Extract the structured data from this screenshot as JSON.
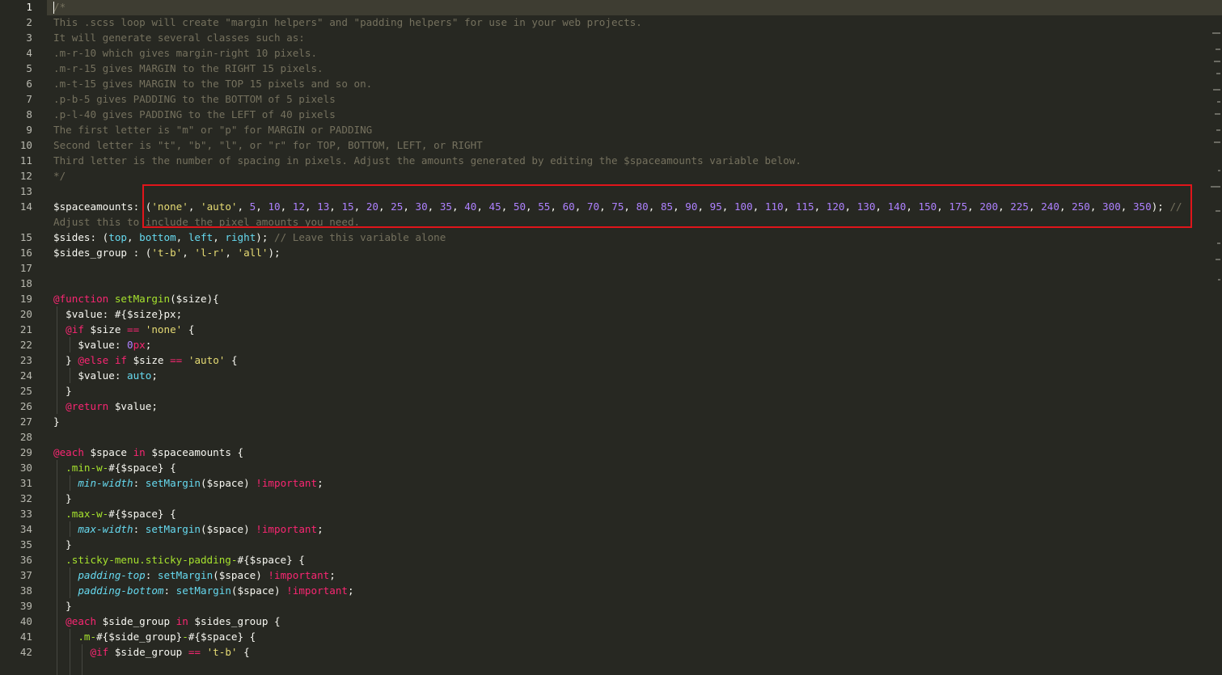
{
  "editor": {
    "language": "scss",
    "current_line": 1,
    "highlight_color": "#e0151b",
    "theme_colors": {
      "background": "#272822",
      "comment": "#75715e",
      "string": "#e6db74",
      "number": "#ae81ff",
      "keyword": "#f92672",
      "function": "#66d9ef",
      "selector": "#a6e22e"
    }
  },
  "line_numbers": [
    "1",
    "2",
    "3",
    "4",
    "5",
    "6",
    "7",
    "8",
    "9",
    "10",
    "11",
    "12",
    "13",
    "14",
    "15",
    "16",
    "17",
    "18",
    "19",
    "20",
    "21",
    "22",
    "23",
    "24",
    "25",
    "26",
    "27",
    "28",
    "29",
    "30",
    "31",
    "32",
    "33",
    "34",
    "35",
    "36",
    "37",
    "38",
    "39",
    "40",
    "41",
    "42"
  ],
  "lines": [
    [
      [
        "c",
        "/*"
      ]
    ],
    [
      [
        "c",
        "This .scss loop will create \"margin helpers\" and \"padding helpers\" for use in your web projects."
      ]
    ],
    [
      [
        "c",
        "It will generate several classes such as:"
      ]
    ],
    [
      [
        "c",
        ".m-r-10 which gives margin-right 10 pixels."
      ]
    ],
    [
      [
        "c",
        ".m-r-15 gives MARGIN to the RIGHT 15 pixels."
      ]
    ],
    [
      [
        "c",
        ".m-t-15 gives MARGIN to the TOP 15 pixels and so on."
      ]
    ],
    [
      [
        "c",
        ".p-b-5 gives PADDING to the BOTTOM of 5 pixels"
      ]
    ],
    [
      [
        "c",
        ".p-l-40 gives PADDING to the LEFT of 40 pixels"
      ]
    ],
    [
      [
        "c",
        "The first letter is \"m\" or \"p\" for MARGIN or PADDING"
      ]
    ],
    [
      [
        "c",
        "Second letter is \"t\", \"b\", \"l\", or \"r\" for TOP, BOTTOM, LEFT, or RIGHT"
      ]
    ],
    [
      [
        "c",
        "Third letter is the number of spacing in pixels. Adjust the amounts generated by editing the $spaceamounts variable below."
      ]
    ],
    [
      [
        "c",
        "*/"
      ]
    ],
    [],
    [
      [
        "p",
        "$spaceamounts: ("
      ],
      [
        "s",
        "'none'"
      ],
      [
        "p",
        ", "
      ],
      [
        "s",
        "'auto'"
      ],
      [
        "p",
        ", "
      ],
      [
        "n",
        "5"
      ],
      [
        "p",
        ", "
      ],
      [
        "n",
        "10"
      ],
      [
        "p",
        ", "
      ],
      [
        "n",
        "12"
      ],
      [
        "p",
        ", "
      ],
      [
        "n",
        "13"
      ],
      [
        "p",
        ", "
      ],
      [
        "n",
        "15"
      ],
      [
        "p",
        ", "
      ],
      [
        "n",
        "20"
      ],
      [
        "p",
        ", "
      ],
      [
        "n",
        "25"
      ],
      [
        "p",
        ", "
      ],
      [
        "n",
        "30"
      ],
      [
        "p",
        ", "
      ],
      [
        "n",
        "35"
      ],
      [
        "p",
        ", "
      ],
      [
        "n",
        "40"
      ],
      [
        "p",
        ", "
      ],
      [
        "n",
        "45"
      ],
      [
        "p",
        ", "
      ],
      [
        "n",
        "50"
      ],
      [
        "p",
        ", "
      ],
      [
        "n",
        "55"
      ],
      [
        "p",
        ", "
      ],
      [
        "n",
        "60"
      ],
      [
        "p",
        ", "
      ],
      [
        "n",
        "70"
      ],
      [
        "p",
        ", "
      ],
      [
        "n",
        "75"
      ],
      [
        "p",
        ", "
      ],
      [
        "n",
        "80"
      ],
      [
        "p",
        ", "
      ],
      [
        "n",
        "85"
      ],
      [
        "p",
        ", "
      ],
      [
        "n",
        "90"
      ],
      [
        "p",
        ", "
      ],
      [
        "n",
        "95"
      ],
      [
        "p",
        ", "
      ],
      [
        "n",
        "100"
      ],
      [
        "p",
        ", "
      ],
      [
        "n",
        "110"
      ],
      [
        "p",
        ", "
      ],
      [
        "n",
        "115"
      ],
      [
        "p",
        ", "
      ],
      [
        "n",
        "120"
      ],
      [
        "p",
        ", "
      ],
      [
        "n",
        "130"
      ],
      [
        "p",
        ", "
      ],
      [
        "n",
        "140"
      ],
      [
        "p",
        ", "
      ],
      [
        "n",
        "150"
      ],
      [
        "p",
        ", "
      ],
      [
        "n",
        "175"
      ],
      [
        "p",
        ", "
      ],
      [
        "n",
        "200"
      ],
      [
        "p",
        ", "
      ],
      [
        "n",
        "225"
      ],
      [
        "p",
        ", "
      ],
      [
        "n",
        "240"
      ],
      [
        "p",
        ", "
      ],
      [
        "n",
        "250"
      ],
      [
        "p",
        ", "
      ],
      [
        "n",
        "300"
      ],
      [
        "p",
        ", "
      ],
      [
        "n",
        "350"
      ],
      [
        "p",
        "); "
      ],
      [
        "c",
        "//"
      ]
    ],
    [
      [
        "c",
        "Adjust this to include the pixel amounts you need."
      ]
    ],
    [
      [
        "p",
        "$sides: ("
      ],
      [
        "f",
        "top"
      ],
      [
        "p",
        ", "
      ],
      [
        "f",
        "bottom"
      ],
      [
        "p",
        ", "
      ],
      [
        "f",
        "left"
      ],
      [
        "p",
        ", "
      ],
      [
        "f",
        "right"
      ],
      [
        "p",
        "); "
      ],
      [
        "c",
        "// Leave this variable alone"
      ]
    ],
    [
      [
        "p",
        "$sides_group : ("
      ],
      [
        "s",
        "'t-b'"
      ],
      [
        "p",
        ", "
      ],
      [
        "s",
        "'l-r'"
      ],
      [
        "p",
        ", "
      ],
      [
        "s",
        "'all'"
      ],
      [
        "p",
        ");"
      ]
    ],
    [],
    [],
    [
      [
        "k",
        "@function"
      ],
      [
        "p",
        " "
      ],
      [
        "g",
        "setMargin"
      ],
      [
        "p",
        "($size){"
      ]
    ],
    [
      [
        "p",
        "  $value: #{$size}px;"
      ]
    ],
    [
      [
        "p",
        "  "
      ],
      [
        "k",
        "@if"
      ],
      [
        "p",
        " $size "
      ],
      [
        "k",
        "=="
      ],
      [
        "p",
        " "
      ],
      [
        "s",
        "'none'"
      ],
      [
        "p",
        " {"
      ]
    ],
    [
      [
        "p",
        "    $value: "
      ],
      [
        "n",
        "0"
      ],
      [
        "k",
        "px"
      ],
      [
        "p",
        ";"
      ]
    ],
    [
      [
        "p",
        "  } "
      ],
      [
        "k",
        "@else if"
      ],
      [
        "p",
        " $size "
      ],
      [
        "k",
        "=="
      ],
      [
        "p",
        " "
      ],
      [
        "s",
        "'auto'"
      ],
      [
        "p",
        " {"
      ]
    ],
    [
      [
        "p",
        "    $value: "
      ],
      [
        "f",
        "auto"
      ],
      [
        "p",
        ";"
      ]
    ],
    [
      [
        "p",
        "  }"
      ]
    ],
    [
      [
        "p",
        "  "
      ],
      [
        "k",
        "@return"
      ],
      [
        "p",
        " $value;"
      ]
    ],
    [
      [
        "p",
        "}"
      ]
    ],
    [],
    [
      [
        "k",
        "@each"
      ],
      [
        "p",
        " $space "
      ],
      [
        "k",
        "in"
      ],
      [
        "p",
        " $spaceamounts {"
      ]
    ],
    [
      [
        "p",
        "  "
      ],
      [
        "g",
        ".min-w-"
      ],
      [
        "p",
        "#{$space} {"
      ]
    ],
    [
      [
        "p",
        "    "
      ],
      [
        "i",
        "min-width"
      ],
      [
        "p",
        ": "
      ],
      [
        "f",
        "setMargin"
      ],
      [
        "p",
        "($space) "
      ],
      [
        "k",
        "!important"
      ],
      [
        "p",
        ";"
      ]
    ],
    [
      [
        "p",
        "  }"
      ]
    ],
    [
      [
        "p",
        "  "
      ],
      [
        "g",
        ".max-w-"
      ],
      [
        "p",
        "#{$space} {"
      ]
    ],
    [
      [
        "p",
        "    "
      ],
      [
        "i",
        "max-width"
      ],
      [
        "p",
        ": "
      ],
      [
        "f",
        "setMargin"
      ],
      [
        "p",
        "($space) "
      ],
      [
        "k",
        "!important"
      ],
      [
        "p",
        ";"
      ]
    ],
    [
      [
        "p",
        "  }"
      ]
    ],
    [
      [
        "p",
        "  "
      ],
      [
        "g",
        ".sticky-menu.sticky-padding-"
      ],
      [
        "p",
        "#{$space} {"
      ]
    ],
    [
      [
        "p",
        "    "
      ],
      [
        "i",
        "padding-top"
      ],
      [
        "p",
        ": "
      ],
      [
        "f",
        "setMargin"
      ],
      [
        "p",
        "($space) "
      ],
      [
        "k",
        "!important"
      ],
      [
        "p",
        ";"
      ]
    ],
    [
      [
        "p",
        "    "
      ],
      [
        "i",
        "padding-bottom"
      ],
      [
        "p",
        ": "
      ],
      [
        "f",
        "setMargin"
      ],
      [
        "p",
        "($space) "
      ],
      [
        "k",
        "!important"
      ],
      [
        "p",
        ";"
      ]
    ],
    [
      [
        "p",
        "  }"
      ]
    ],
    [
      [
        "p",
        "  "
      ],
      [
        "k",
        "@each"
      ],
      [
        "p",
        " $side_group "
      ],
      [
        "k",
        "in"
      ],
      [
        "p",
        " $sides_group {"
      ]
    ],
    [
      [
        "p",
        "    "
      ],
      [
        "g",
        ".m-"
      ],
      [
        "p",
        "#{$side_group}"
      ],
      [
        "g",
        "-"
      ],
      [
        "p",
        "#{$space} {"
      ]
    ],
    [
      [
        "p",
        "      "
      ],
      [
        "k",
        "@if"
      ],
      [
        "p",
        " $side_group "
      ],
      [
        "k",
        "=="
      ],
      [
        "p",
        " "
      ],
      [
        "s",
        "'t-b'"
      ],
      [
        "p",
        " {"
      ]
    ]
  ]
}
